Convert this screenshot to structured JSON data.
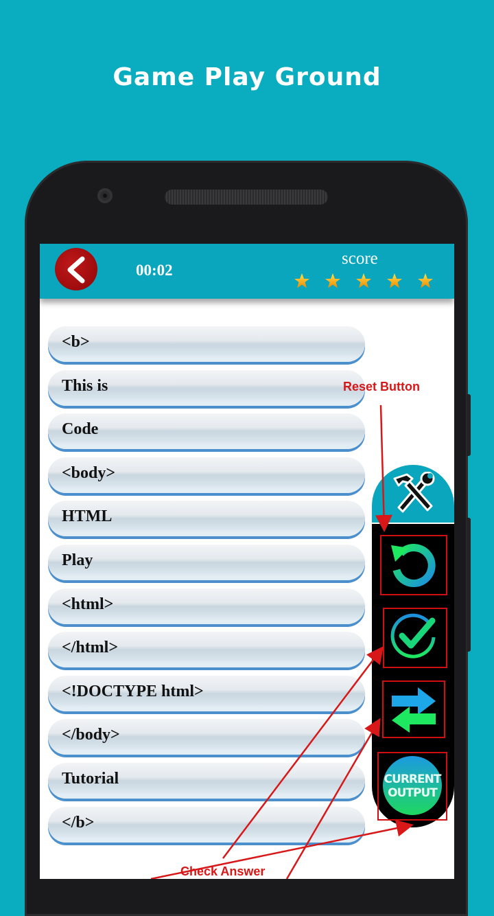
{
  "headline": "Game Play Ground",
  "topbar": {
    "back_icon": "chevron-left-icon",
    "timer": "00:02",
    "score_label": "score",
    "stars_filled": 5,
    "stars_total": 5
  },
  "items": [
    {
      "label": "<b>"
    },
    {
      "label": "This is"
    },
    {
      "label": "Code"
    },
    {
      "label": "<body>"
    },
    {
      "label": "HTML"
    },
    {
      "label": "Play"
    },
    {
      "label": "<html>"
    },
    {
      "label": "</html>"
    },
    {
      "label": "<!DOCTYPE html>"
    },
    {
      "label": "</body>"
    },
    {
      "label": "Tutorial"
    },
    {
      "label": "</b>"
    }
  ],
  "tools": {
    "header_icon": "hammer-wrench-icon",
    "reset_icon": "reset-icon",
    "check_icon": "check-circle-icon",
    "swap_icon": "swap-arrows-icon",
    "output_line1": "CURRENT",
    "output_line2": "OUTPUT"
  },
  "annotations": {
    "reset": "Reset Button",
    "check": "Check Answer"
  },
  "colors": {
    "background": "#0aacc0",
    "topbar": "#0aa6bd",
    "annotation": "#d81818",
    "item_border": "#4b8fcd"
  }
}
